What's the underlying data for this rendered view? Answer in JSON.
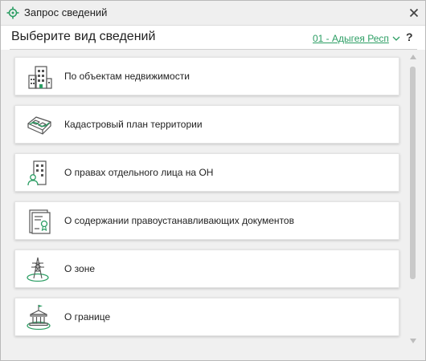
{
  "window": {
    "title": "Запрос сведений",
    "app_icon": "crosshair-target-icon",
    "close_icon": "close-icon"
  },
  "header": {
    "title": "Выберите вид сведений",
    "region": "01 - Адыгея Респ",
    "help": "?"
  },
  "items": [
    {
      "label": "По объектам недвижимости",
      "icon": "buildings-icon"
    },
    {
      "label": "Кадастровый план территории",
      "icon": "land-plot-icon"
    },
    {
      "label": "О правах отдельного лица на ОН",
      "icon": "person-building-icon"
    },
    {
      "label": "О содержании правоустанавливающих документов",
      "icon": "certificate-document-icon"
    },
    {
      "label": "О зоне",
      "icon": "power-tower-zone-icon"
    },
    {
      "label": "О границе",
      "icon": "government-building-icon"
    }
  ],
  "colors": {
    "accent": "#2c9e64",
    "icon_stroke": "#555555"
  }
}
